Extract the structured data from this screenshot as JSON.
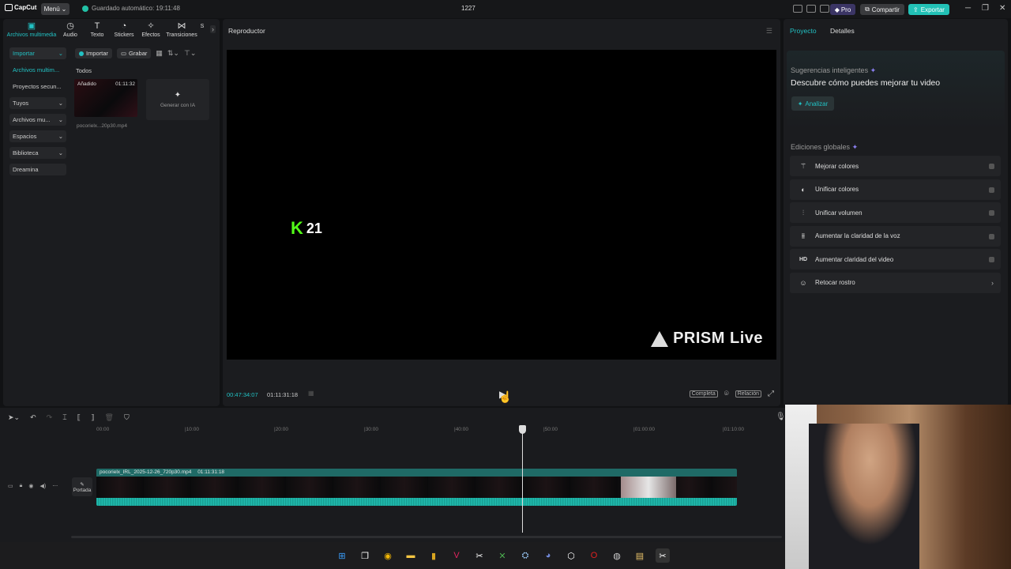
{
  "titlebar": {
    "app_name": "CapCut",
    "menu_label": "Menú",
    "autosave": "Guardado automático: 19:11:48",
    "project_name": "1227",
    "pro_label": "Pro",
    "share_label": "Compartir",
    "export_label": "Exportar"
  },
  "left_panel": {
    "tabs": [
      {
        "label": "Archivos multimedia",
        "icon": "media-icon"
      },
      {
        "label": "Audio",
        "icon": "audio-icon"
      },
      {
        "label": "Texto",
        "icon": "text-icon"
      },
      {
        "label": "Stickers",
        "icon": "stickers-icon"
      },
      {
        "label": "Efectos",
        "icon": "effects-icon"
      },
      {
        "label": "Transiciones",
        "icon": "transitions-icon"
      },
      {
        "label": "S",
        "icon": ""
      }
    ],
    "nav": [
      {
        "label": "Importar"
      },
      {
        "label": "Archivos multim..."
      },
      {
        "label": "Proyectos secun..."
      },
      {
        "label": "Tuyos"
      },
      {
        "label": "Archivos mu..."
      },
      {
        "label": "Espacios"
      },
      {
        "label": "Biblioteca"
      },
      {
        "label": "Dreamina"
      }
    ],
    "import_btn": "Importar",
    "record_btn": "Grabar",
    "filter_all": "Todos",
    "media_item": {
      "badge": "Añadido",
      "duration": "01:11:32",
      "filename": "pocorielx...20p30.mp4"
    },
    "generate_ai": "Generar con IA"
  },
  "player": {
    "title": "Reproductor",
    "overlay_number": "21",
    "watermark": "PRISM Live",
    "current_time": "00:47:34:07",
    "total_time": "01:11:31:18",
    "full_label": "Completa",
    "ratio_label": "Relación"
  },
  "right_panel": {
    "tab_project": "Proyecto",
    "tab_details": "Detalles",
    "suggestions_title": "Sugerencias inteligentes",
    "suggestions_desc": "Descubre cómo puedes mejorar tu video",
    "analyze_label": "Analizar",
    "global_title": "Ediciones globales",
    "global_items": [
      {
        "label": "Mejorar colores",
        "icon": "magic-wand-icon"
      },
      {
        "label": "Unificar colores",
        "icon": "palette-icon"
      },
      {
        "label": "Unificar volumen",
        "icon": "sliders-icon"
      },
      {
        "label": "Aumentar la claridad de la voz",
        "icon": "voice-wave-icon"
      },
      {
        "label": "Aumentar claridad del video",
        "icon": "hd-icon"
      },
      {
        "label": "Retocar rostro",
        "icon": "face-retouch-icon"
      }
    ]
  },
  "timeline": {
    "ruler": [
      "00:00",
      "|10:00",
      "|20:00",
      "|30:00",
      "|40:00",
      "|50:00",
      "|01:00:00",
      "|01:10:00"
    ],
    "clip_name": "pocorielx_IRL_2025-12-26_720p30.mp4",
    "clip_duration": "01:11:31:18",
    "cover_label": "Portada"
  },
  "colors": {
    "accent": "#22c1c3",
    "export": "#22c1b6",
    "kick_green": "#53fc18"
  }
}
